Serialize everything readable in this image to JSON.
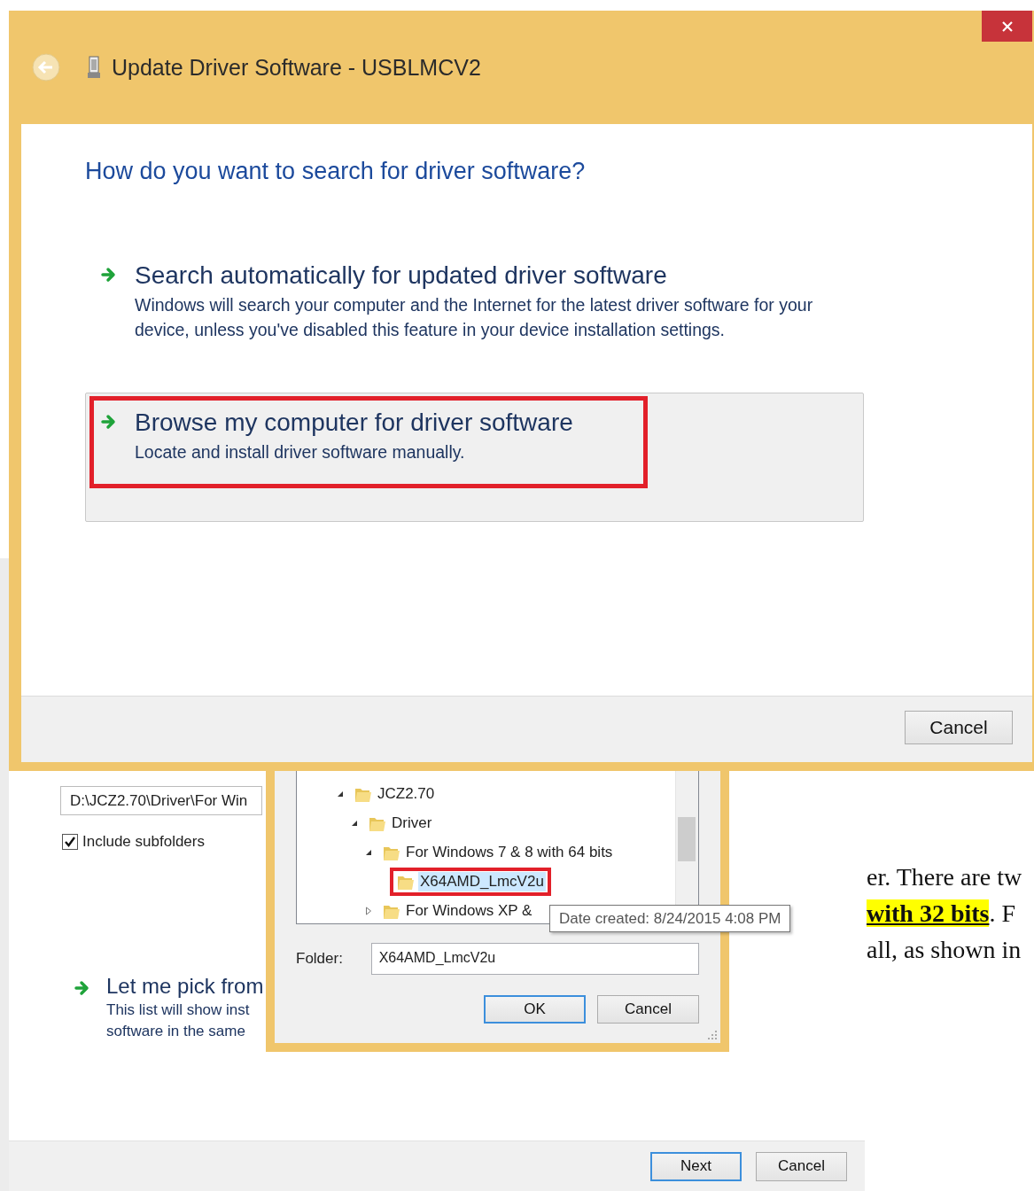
{
  "front_window": {
    "title": "Update Driver Software - USBLMCV2",
    "heading": "How do you want to search for driver software?",
    "options": [
      {
        "title": "Search automatically for updated driver software",
        "description": "Windows will search your computer and the Internet for the latest driver software for your device, unless you've disabled this feature in your device installation settings.",
        "selected": false,
        "highlighted": false
      },
      {
        "title": "Browse my computer for driver software",
        "description": "Locate and install driver software manually.",
        "selected": true,
        "highlighted": true
      }
    ],
    "buttons": [
      {
        "label": "Cancel",
        "default": false
      }
    ]
  },
  "back_window": {
    "path_field": {
      "value": "D:\\JCZ2.70\\Driver\\For Win"
    },
    "include_subfolders": {
      "label": "Include subfolders",
      "checked": true
    },
    "pick_option": {
      "title": "Let me pick from",
      "description": [
        "This list will show inst",
        "software in the same"
      ]
    },
    "buttons": [
      {
        "label": "Next",
        "default": true
      },
      {
        "label": "Cancel",
        "default": false
      }
    ]
  },
  "folder_dialog": {
    "tree": [
      {
        "label": "JCZ2.70",
        "expanded": true,
        "children": [
          {
            "label": "Driver",
            "expanded": true,
            "children": [
              {
                "label": "For Windows 7 & 8 with 64 bits",
                "expanded": true,
                "children": [
                  {
                    "label": "X64AMD_LmcV2u",
                    "selected": true,
                    "highlighted": true
                  }
                ]
              },
              {
                "label": "For Windows XP &",
                "expanded": false,
                "selected": false,
                "highlighted": false
              }
            ]
          }
        ]
      }
    ],
    "tooltip": "Date created: 8/24/2015 4:08 PM",
    "folder": {
      "label": "Folder:",
      "value": "X64AMD_LmcV2u"
    },
    "buttons": [
      {
        "label": "OK",
        "default": true
      },
      {
        "label": "Cancel",
        "default": false
      }
    ]
  },
  "document_text": [
    "er. There are tw",
    "**with 32 bits**. F",
    "all, as shown in"
  ]
}
